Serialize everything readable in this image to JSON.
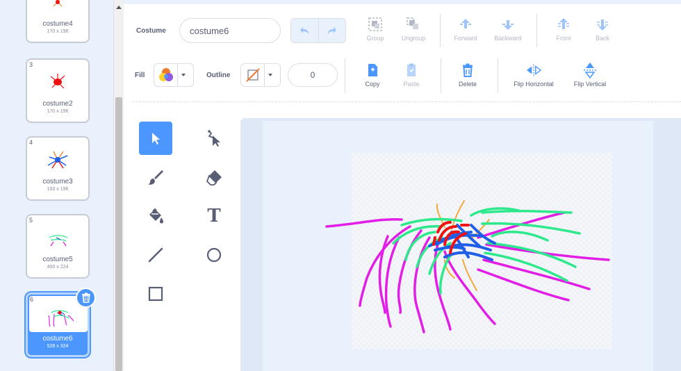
{
  "costume_list": {
    "items": [
      {
        "number": "",
        "name": "costume4",
        "size": "170 x 196"
      },
      {
        "number": "3",
        "name": "costume2",
        "size": "170 x 196"
      },
      {
        "number": "4",
        "name": "costume3",
        "size": "193 x 196"
      },
      {
        "number": "5",
        "name": "costume5",
        "size": "400 x 224"
      },
      {
        "number": "6",
        "name": "costume6",
        "size": "528 x 324",
        "selected": true
      }
    ]
  },
  "toolbar": {
    "costume_label": "Costume",
    "costume_name": "costume6",
    "group_label": "Group",
    "ungroup_label": "Ungroup",
    "forward_label": "Forward",
    "backward_label": "Backward",
    "front_label": "Front",
    "back_label": "Back",
    "fill_label": "Fill",
    "outline_label": "Outline",
    "outline_width": "0",
    "copy_label": "Copy",
    "paste_label": "Paste",
    "delete_label": "Delete",
    "flip_horizontal_label": "Flip Horizontal",
    "flip_vertical_label": "Flip Vertical"
  },
  "draw_tools": {
    "items": [
      "select-tool",
      "reshape-tool",
      "brush-tool",
      "eraser-tool",
      "fill-tool",
      "text-tool",
      "line-tool",
      "circle-tool",
      "rectangle-tool"
    ],
    "active": "select-tool",
    "text_tool_glyph": "T"
  },
  "colors": {
    "accent": "#4c97ff",
    "text": "#575e75",
    "disabled_icon": "#b3b8c4",
    "stroke_magenta": "#e21ee6",
    "stroke_green": "#2ee88c",
    "stroke_blue": "#1f5ee6",
    "stroke_red": "#ee1212",
    "stroke_orange": "#f4a83a"
  }
}
